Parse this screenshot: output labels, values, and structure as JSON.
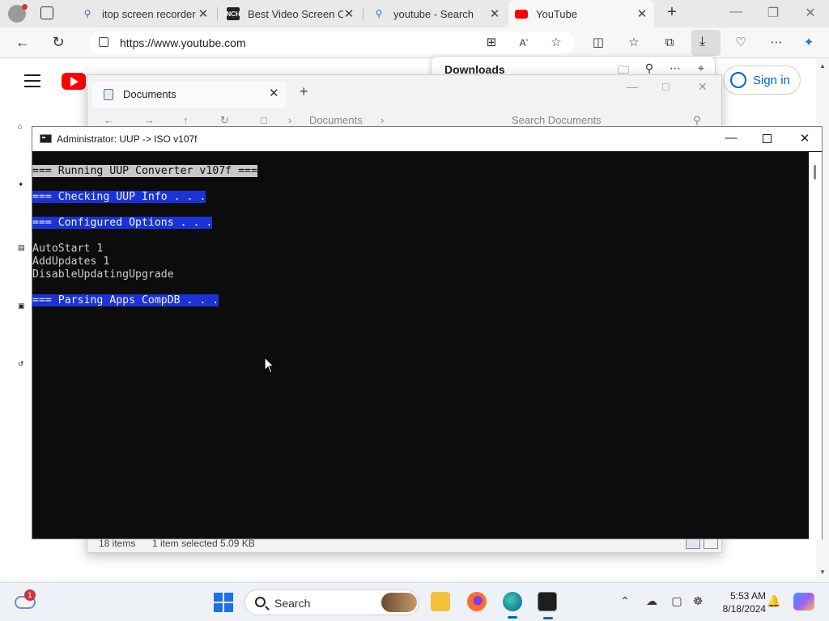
{
  "browser": {
    "tabs": [
      {
        "title": "itop screen recorder",
        "favicon": "search-icon"
      },
      {
        "title": "Best Video Screen Ca",
        "favicon": "nch-logo-icon"
      },
      {
        "title": "youtube - Search",
        "favicon": "search-icon"
      },
      {
        "title": "YouTube",
        "favicon": "youtube-icon"
      }
    ],
    "url": "https://www.youtube.com",
    "downloads_title": "Downloads",
    "signin_label": "Sign in"
  },
  "explorer": {
    "tab_title": "Documents",
    "breadcrumb": "Documents",
    "search_placeholder": "Search Documents",
    "status_items": "18 items",
    "status_selected": "1 item selected  5.09 KB"
  },
  "console": {
    "title": "Administrator:  UUP -> ISO v107f",
    "lines": [
      {
        "text": "=== Running UUP Converter v107f ===",
        "style": "gray"
      },
      {
        "text": "",
        "style": "none"
      },
      {
        "text": "=== Checking UUP Info . . .",
        "style": "blue"
      },
      {
        "text": "",
        "style": "none"
      },
      {
        "text": "=== Configured Options . . .",
        "style": "blue"
      },
      {
        "text": "",
        "style": "none"
      },
      {
        "text": "AutoStart 1",
        "style": "none"
      },
      {
        "text": "AddUpdates 1",
        "style": "none"
      },
      {
        "text": "DisableUpdatingUpgrade",
        "style": "none"
      },
      {
        "text": "",
        "style": "none"
      },
      {
        "text": "=== Parsing Apps CompDB . . .",
        "style": "blue"
      }
    ]
  },
  "taskbar": {
    "weather_badge": "1",
    "search_label": "Search",
    "time": "5:53 AM",
    "date": "8/18/2024"
  },
  "colors": {
    "console_bg": "#0c0c0c",
    "highlight_blue": "#1a33d9",
    "highlight_gray": "#c8c8c8",
    "youtube_red": "#ff0000",
    "accent": "#0067c0"
  }
}
